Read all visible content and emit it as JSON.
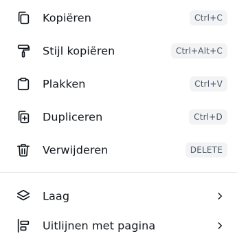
{
  "menu": {
    "items": [
      {
        "label": "Kopiëren",
        "shortcut": "Ctrl+C",
        "icon": "copy-icon"
      },
      {
        "label": "Stijl kopiëren",
        "shortcut": "Ctrl+Alt+C",
        "icon": "paint-roller-icon"
      },
      {
        "label": "Plakken",
        "shortcut": "Ctrl+V",
        "icon": "clipboard-icon"
      },
      {
        "label": "Dupliceren",
        "shortcut": "Ctrl+D",
        "icon": "duplicate-icon"
      },
      {
        "label": "Verwijderen",
        "shortcut": "DELETE",
        "icon": "trash-icon"
      }
    ],
    "submenus": [
      {
        "label": "Laag",
        "icon": "layers-icon",
        "arrow_icon": "chevron-right-icon"
      },
      {
        "label": "Uitlijnen met pagina",
        "icon": "align-left-icon",
        "arrow_icon": "chevron-right-icon"
      }
    ]
  }
}
